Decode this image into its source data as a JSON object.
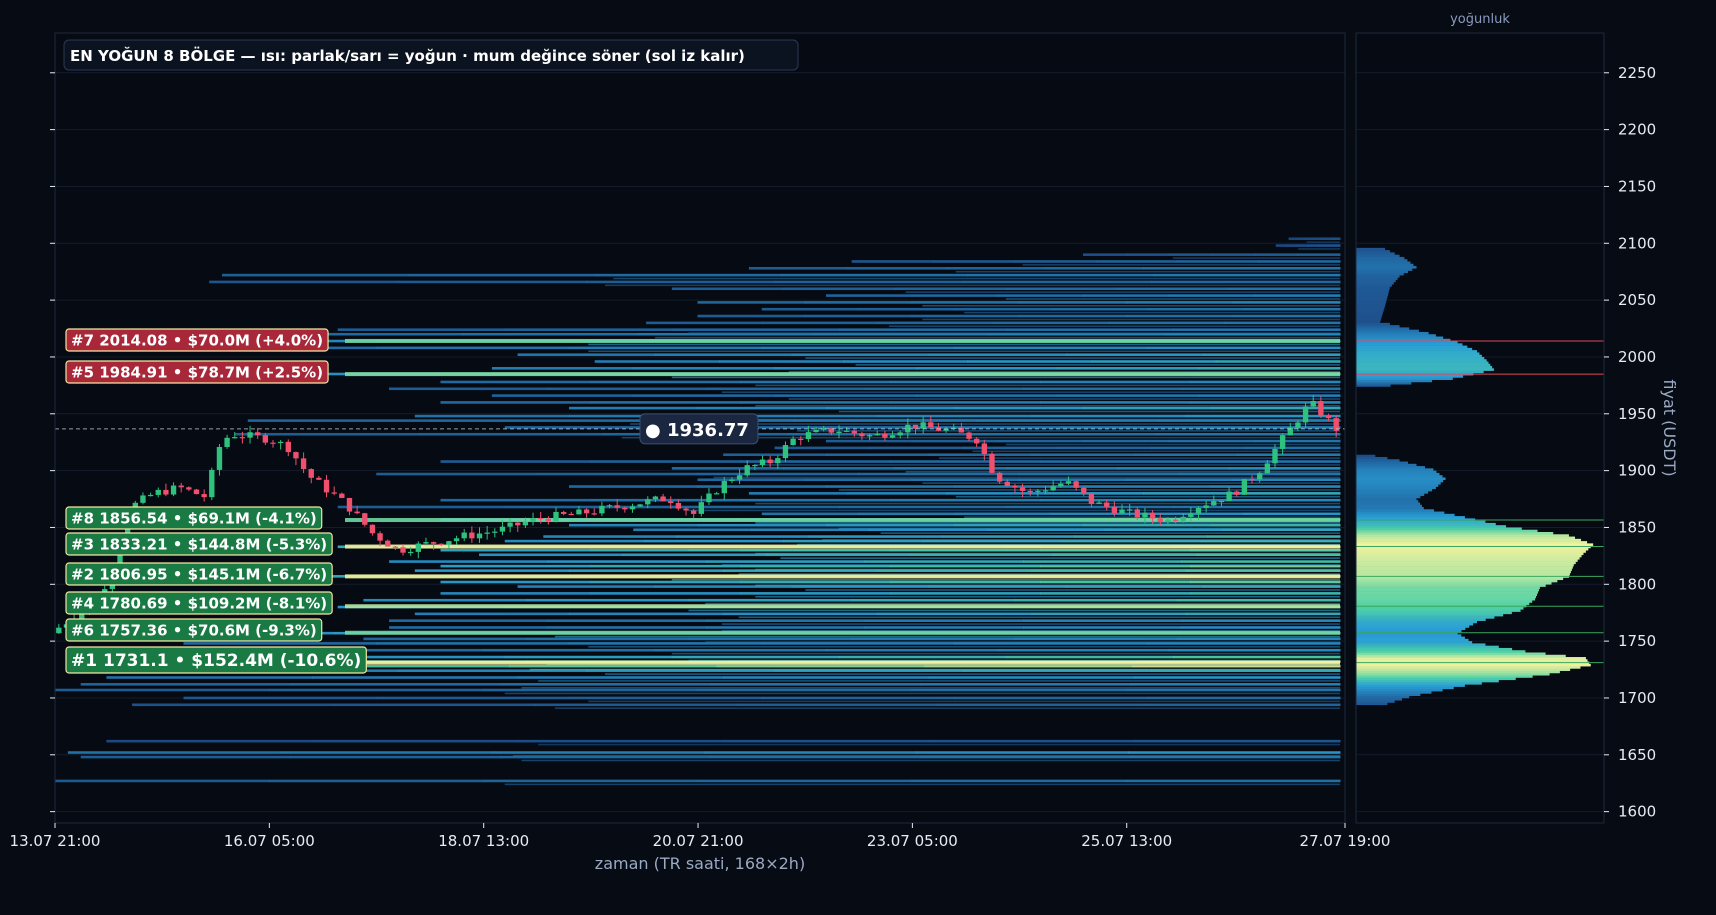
{
  "chart_data": {
    "type": "heatmap",
    "title": "EN YOĞUN 8 BÖLGE — ısı: parlak/sarı = yoğun · mum değince söner (sol iz kalır)",
    "xlabel": "zaman (TR saati, 168×2h)",
    "ylabel": "fiyat (USDT)",
    "side_panel_title": "yoğunluk",
    "ylim": [
      1590,
      2285
    ],
    "y_ticks": [
      1600,
      1650,
      1700,
      1750,
      1800,
      1850,
      1900,
      1950,
      2000,
      2050,
      2100,
      2150,
      2200,
      2250
    ],
    "x_range": [
      "13.07 21:00",
      "27.07 19:00"
    ],
    "x_ticks": [
      "13.07 21:00",
      "16.07 05:00",
      "18.07 13:00",
      "20.07 21:00",
      "23.07 05:00",
      "25.07 13:00",
      "27.07 19:00"
    ],
    "current_price": 1936.77,
    "current_price_label": "● 1936.77",
    "colors": {
      "up": "#2ec27e",
      "down": "#f0506e",
      "background": "#070b13",
      "zone_above": "#a8283a",
      "zone_below": "#1a7a44",
      "zone_border": "#f3e7a0",
      "heat_low": "#1a3a78",
      "heat_mid": "#2a9fd6",
      "heat_midhigh": "#4fd1a5",
      "heat_high": "#fff59d"
    },
    "zones": [
      {
        "rank": 7,
        "label": "#7  2014.08  •  $70.0M  (+4.0%)",
        "price": 2014.08,
        "value_musd": 70.0,
        "pct": 4.0,
        "side": "above"
      },
      {
        "rank": 5,
        "label": "#5  1984.91  •  $78.7M  (+2.5%)",
        "price": 1984.91,
        "value_musd": 78.7,
        "pct": 2.5,
        "side": "above"
      },
      {
        "rank": 8,
        "label": "#8  1856.54  •  $69.1M  (-4.1%)",
        "price": 1856.54,
        "value_musd": 69.1,
        "pct": -4.1,
        "side": "below"
      },
      {
        "rank": 3,
        "label": "#3  1833.21  •  $144.8M  (-5.3%)",
        "price": 1833.21,
        "value_musd": 144.8,
        "pct": -5.3,
        "side": "below"
      },
      {
        "rank": 2,
        "label": "#2  1806.95  •  $145.1M  (-6.7%)",
        "price": 1806.95,
        "value_musd": 145.1,
        "pct": -6.7,
        "side": "below"
      },
      {
        "rank": 4,
        "label": "#4  1780.69  •  $109.2M  (-8.1%)",
        "price": 1780.69,
        "value_musd": 109.2,
        "pct": -8.1,
        "side": "below"
      },
      {
        "rank": 6,
        "label": "#6  1757.36  •  $70.6M  (-9.3%)",
        "price": 1757.36,
        "value_musd": 70.6,
        "pct": -9.3,
        "side": "below"
      },
      {
        "rank": 1,
        "label": "#1  1731.1  •  $152.4M  (-10.6%)",
        "price": 1731.1,
        "value_musd": 152.4,
        "pct": -10.6,
        "side": "below"
      }
    ],
    "density_profile": [
      {
        "price": 1648,
        "density": 0.1
      },
      {
        "price": 1692,
        "density": 0.1
      },
      {
        "price": 1700,
        "density": 0.22
      },
      {
        "price": 1710,
        "density": 0.45
      },
      {
        "price": 1720,
        "density": 0.8
      },
      {
        "price": 1728,
        "density": 0.97
      },
      {
        "price": 1734,
        "density": 0.95
      },
      {
        "price": 1740,
        "density": 0.7
      },
      {
        "price": 1748,
        "density": 0.48
      },
      {
        "price": 1756,
        "density": 0.42
      },
      {
        "price": 1766,
        "density": 0.5
      },
      {
        "price": 1776,
        "density": 0.68
      },
      {
        "price": 1786,
        "density": 0.74
      },
      {
        "price": 1796,
        "density": 0.76
      },
      {
        "price": 1806,
        "density": 0.88
      },
      {
        "price": 1816,
        "density": 0.9
      },
      {
        "price": 1826,
        "density": 0.94
      },
      {
        "price": 1834,
        "density": 0.98
      },
      {
        "price": 1842,
        "density": 0.88
      },
      {
        "price": 1850,
        "density": 0.62
      },
      {
        "price": 1858,
        "density": 0.45
      },
      {
        "price": 1866,
        "density": 0.28
      },
      {
        "price": 1874,
        "density": 0.25
      },
      {
        "price": 1884,
        "density": 0.33
      },
      {
        "price": 1892,
        "density": 0.37
      },
      {
        "price": 1900,
        "density": 0.32
      },
      {
        "price": 1908,
        "density": 0.18
      },
      {
        "price": 1912,
        "density": 0.08
      },
      {
        "price": 1973,
        "density": 0.1
      },
      {
        "price": 1980,
        "density": 0.4
      },
      {
        "price": 1988,
        "density": 0.57
      },
      {
        "price": 1996,
        "density": 0.54
      },
      {
        "price": 2004,
        "density": 0.5
      },
      {
        "price": 2012,
        "density": 0.42
      },
      {
        "price": 2020,
        "density": 0.3
      },
      {
        "price": 2030,
        "density": 0.1
      },
      {
        "price": 2044,
        "density": 0.12
      },
      {
        "price": 2052,
        "density": 0.13
      },
      {
        "price": 2060,
        "density": 0.14
      },
      {
        "price": 2070,
        "density": 0.18
      },
      {
        "price": 2078,
        "density": 0.25
      },
      {
        "price": 2086,
        "density": 0.2
      },
      {
        "price": 2094,
        "density": 0.12
      }
    ],
    "heat_bands": [
      {
        "price": 1627,
        "start": 0.0,
        "intensity": 0.28
      },
      {
        "price": 1652,
        "start": 0.01,
        "intensity": 0.45
      },
      {
        "price": 1648,
        "start": 0.02,
        "intensity": 0.3
      },
      {
        "price": 1662,
        "start": 0.04,
        "intensity": 0.15
      },
      {
        "price": 1694,
        "start": 0.06,
        "intensity": 0.22
      },
      {
        "price": 1700,
        "start": 0.1,
        "intensity": 0.25
      },
      {
        "price": 1707,
        "start": 0.0,
        "intensity": 0.3
      },
      {
        "price": 1712,
        "start": 0.02,
        "intensity": 0.35
      },
      {
        "price": 1718,
        "start": 0.04,
        "intensity": 0.45
      },
      {
        "price": 1724,
        "start": 0.12,
        "intensity": 0.55
      },
      {
        "price": 1728,
        "start": 0.03,
        "intensity": 0.95
      },
      {
        "price": 1732,
        "start": 0.05,
        "intensity": 0.9
      },
      {
        "price": 1736,
        "start": 0.22,
        "intensity": 0.7
      },
      {
        "price": 1742,
        "start": 0.2,
        "intensity": 0.4
      },
      {
        "price": 1748,
        "start": 0.1,
        "intensity": 0.4
      },
      {
        "price": 1752,
        "start": 0.24,
        "intensity": 0.38
      },
      {
        "price": 1757,
        "start": 0.06,
        "intensity": 0.7
      },
      {
        "price": 1762,
        "start": 0.26,
        "intensity": 0.42
      },
      {
        "price": 1768,
        "start": 0.26,
        "intensity": 0.4
      },
      {
        "price": 1774,
        "start": 0.28,
        "intensity": 0.55
      },
      {
        "price": 1780,
        "start": 0.22,
        "intensity": 0.72
      },
      {
        "price": 1786,
        "start": 0.24,
        "intensity": 0.65
      },
      {
        "price": 1792,
        "start": 0.3,
        "intensity": 0.62
      },
      {
        "price": 1798,
        "start": 0.36,
        "intensity": 0.58
      },
      {
        "price": 1802,
        "start": 0.3,
        "intensity": 0.75
      },
      {
        "price": 1807,
        "start": 0.2,
        "intensity": 0.88
      },
      {
        "price": 1812,
        "start": 0.28,
        "intensity": 0.72
      },
      {
        "price": 1816,
        "start": 0.3,
        "intensity": 0.8
      },
      {
        "price": 1820,
        "start": 0.26,
        "intensity": 0.65
      },
      {
        "price": 1826,
        "start": 0.33,
        "intensity": 0.7
      },
      {
        "price": 1830,
        "start": 0.3,
        "intensity": 0.82
      },
      {
        "price": 1833,
        "start": 0.22,
        "intensity": 0.92
      },
      {
        "price": 1838,
        "start": 0.35,
        "intensity": 0.65
      },
      {
        "price": 1842,
        "start": 0.38,
        "intensity": 0.62
      },
      {
        "price": 1848,
        "start": 0.45,
        "intensity": 0.55
      },
      {
        "price": 1852,
        "start": 0.4,
        "intensity": 0.6
      },
      {
        "price": 1857,
        "start": 0.3,
        "intensity": 0.72
      },
      {
        "price": 1862,
        "start": 0.55,
        "intensity": 0.45
      },
      {
        "price": 1868,
        "start": 0.22,
        "intensity": 0.3
      },
      {
        "price": 1874,
        "start": 0.3,
        "intensity": 0.4
      },
      {
        "price": 1880,
        "start": 0.54,
        "intensity": 0.55
      },
      {
        "price": 1886,
        "start": 0.4,
        "intensity": 0.4
      },
      {
        "price": 1892,
        "start": 0.5,
        "intensity": 0.38
      },
      {
        "price": 1897,
        "start": 0.25,
        "intensity": 0.3
      },
      {
        "price": 1902,
        "start": 0.48,
        "intensity": 0.42
      },
      {
        "price": 1908,
        "start": 0.3,
        "intensity": 0.3
      },
      {
        "price": 1914,
        "start": 0.52,
        "intensity": 0.32
      },
      {
        "price": 1920,
        "start": 0.56,
        "intensity": 0.28
      },
      {
        "price": 1926,
        "start": 0.6,
        "intensity": 0.3
      },
      {
        "price": 1932,
        "start": 0.14,
        "intensity": 0.3
      },
      {
        "price": 1938,
        "start": 0.35,
        "intensity": 0.35
      },
      {
        "price": 1944,
        "start": 0.15,
        "intensity": 0.35
      },
      {
        "price": 1948,
        "start": 0.28,
        "intensity": 0.45
      },
      {
        "price": 1955,
        "start": 0.4,
        "intensity": 0.55
      },
      {
        "price": 1960,
        "start": 0.3,
        "intensity": 0.4
      },
      {
        "price": 1966,
        "start": 0.34,
        "intensity": 0.35
      },
      {
        "price": 1972,
        "start": 0.26,
        "intensity": 0.3
      },
      {
        "price": 1978,
        "start": 0.3,
        "intensity": 0.4
      },
      {
        "price": 1985,
        "start": 0.2,
        "intensity": 0.7
      },
      {
        "price": 1990,
        "start": 0.34,
        "intensity": 0.55
      },
      {
        "price": 1996,
        "start": 0.42,
        "intensity": 0.55
      },
      {
        "price": 2002,
        "start": 0.36,
        "intensity": 0.5
      },
      {
        "price": 2008,
        "start": 0.1,
        "intensity": 0.42
      },
      {
        "price": 2014,
        "start": 0.1,
        "intensity": 0.62
      },
      {
        "price": 2020,
        "start": 0.18,
        "intensity": 0.4
      },
      {
        "price": 2024,
        "start": 0.22,
        "intensity": 0.3
      },
      {
        "price": 2030,
        "start": 0.46,
        "intensity": 0.3
      },
      {
        "price": 2036,
        "start": 0.5,
        "intensity": 0.3
      },
      {
        "price": 2042,
        "start": 0.55,
        "intensity": 0.3
      },
      {
        "price": 2048,
        "start": 0.5,
        "intensity": 0.38
      },
      {
        "price": 2054,
        "start": 0.6,
        "intensity": 0.35
      },
      {
        "price": 2060,
        "start": 0.48,
        "intensity": 0.3
      },
      {
        "price": 2066,
        "start": 0.12,
        "intensity": 0.25
      },
      {
        "price": 2072,
        "start": 0.13,
        "intensity": 0.32
      },
      {
        "price": 2078,
        "start": 0.54,
        "intensity": 0.3
      },
      {
        "price": 2084,
        "start": 0.62,
        "intensity": 0.25
      },
      {
        "price": 2090,
        "start": 0.8,
        "intensity": 0.2
      },
      {
        "price": 2098,
        "start": 0.95,
        "intensity": 0.15
      },
      {
        "price": 2104,
        "start": 0.96,
        "intensity": 0.12
      }
    ],
    "candle_path": [
      {
        "t": 0.0,
        "p": 1757
      },
      {
        "t": 0.04,
        "p": 1790
      },
      {
        "t": 0.065,
        "p": 1870
      },
      {
        "t": 0.08,
        "p": 1880
      },
      {
        "t": 0.1,
        "p": 1885
      },
      {
        "t": 0.12,
        "p": 1877
      },
      {
        "t": 0.132,
        "p": 1925
      },
      {
        "t": 0.14,
        "p": 1932
      },
      {
        "t": 0.17,
        "p": 1928
      },
      {
        "t": 0.185,
        "p": 1920
      },
      {
        "t": 0.2,
        "p": 1896
      },
      {
        "t": 0.23,
        "p": 1870
      },
      {
        "t": 0.25,
        "p": 1845
      },
      {
        "t": 0.27,
        "p": 1830
      },
      {
        "t": 0.29,
        "p": 1835
      },
      {
        "t": 0.32,
        "p": 1842
      },
      {
        "t": 0.35,
        "p": 1848
      },
      {
        "t": 0.38,
        "p": 1858
      },
      {
        "t": 0.41,
        "p": 1862
      },
      {
        "t": 0.45,
        "p": 1870
      },
      {
        "t": 0.48,
        "p": 1876
      },
      {
        "t": 0.5,
        "p": 1862
      },
      {
        "t": 0.52,
        "p": 1886
      },
      {
        "t": 0.54,
        "p": 1902
      },
      {
        "t": 0.56,
        "p": 1908
      },
      {
        "t": 0.58,
        "p": 1930
      },
      {
        "t": 0.61,
        "p": 1936
      },
      {
        "t": 0.64,
        "p": 1930
      },
      {
        "t": 0.67,
        "p": 1940
      },
      {
        "t": 0.7,
        "p": 1935
      },
      {
        "t": 0.72,
        "p": 1928
      },
      {
        "t": 0.735,
        "p": 1895
      },
      {
        "t": 0.76,
        "p": 1880
      },
      {
        "t": 0.79,
        "p": 1890
      },
      {
        "t": 0.81,
        "p": 1872
      },
      {
        "t": 0.84,
        "p": 1862
      },
      {
        "t": 0.87,
        "p": 1856
      },
      {
        "t": 0.89,
        "p": 1868
      },
      {
        "t": 0.92,
        "p": 1880
      },
      {
        "t": 0.94,
        "p": 1900
      },
      {
        "t": 0.96,
        "p": 1930
      },
      {
        "t": 0.98,
        "p": 1960
      },
      {
        "t": 1.0,
        "p": 1937
      }
    ]
  }
}
